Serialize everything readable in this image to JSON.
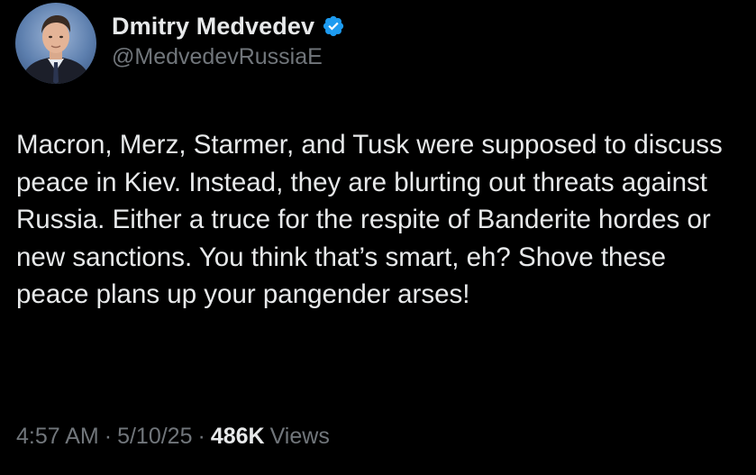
{
  "author": {
    "display_name": "Dmitry Medvedev",
    "handle": "@MedvedevRussiaE",
    "verified_color": "#1d9bf0",
    "avatar_icon": "profile-photo"
  },
  "tweet": {
    "text": "Macron, Merz, Starmer, and Tusk were supposed to discuss peace in Kiev. Instead, they are blurting out threats against Russia. Either a truce for the respite of Banderite hordes or new sanctions. You think that’s smart, eh? Shove these peace plans up your pangender arses!"
  },
  "meta": {
    "time": "4:57 AM",
    "separator": "·",
    "date": "5/10/25",
    "views_count": "486K",
    "views_label": "Views"
  },
  "colors": {
    "background": "#000000",
    "primary_text": "#e7e9ea",
    "secondary_text": "#71767b"
  }
}
